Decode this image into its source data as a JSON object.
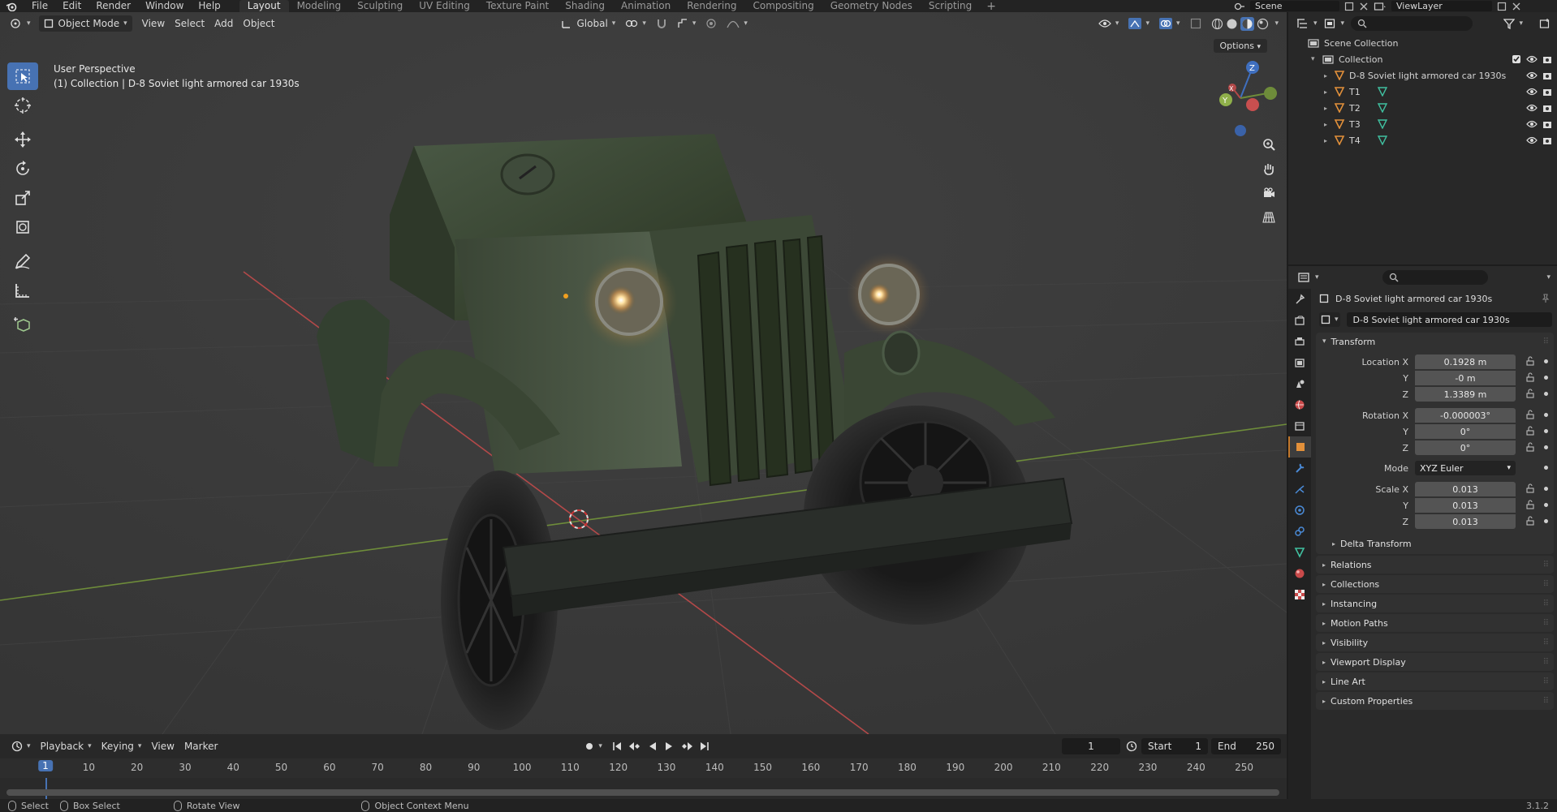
{
  "topbar": {
    "menus": [
      "File",
      "Edit",
      "Render",
      "Window",
      "Help"
    ],
    "workspaces": [
      "Layout",
      "Modeling",
      "Sculpting",
      "UV Editing",
      "Texture Paint",
      "Shading",
      "Animation",
      "Rendering",
      "Compositing",
      "Geometry Nodes",
      "Scripting"
    ],
    "active_workspace": "Layout",
    "add_workspace": "+",
    "scene": "Scene",
    "view_layer": "ViewLayer"
  },
  "viewport": {
    "mode": "Object Mode",
    "menus": [
      "View",
      "Select",
      "Add",
      "Object"
    ],
    "transform_orientation": "Global",
    "options_label": "Options",
    "perspective_label": "User Perspective",
    "collection_label": "(1) Collection | D-8 Soviet light armored car 1930s",
    "gizmo_axes": {
      "x": "X",
      "y": "Y",
      "z": "Z"
    },
    "colors": {
      "bg": "#393939",
      "x_axis": "#b34949",
      "y_axis": "#6e8c3a",
      "z_axis": "#3f6fbf",
      "body_green": "#3d4a38",
      "headlight": "#ffcf7a"
    }
  },
  "timeline": {
    "menus": [
      "Playback",
      "Keying",
      "View",
      "Marker"
    ],
    "current_frame": "1",
    "start_label": "Start",
    "start_value": "1",
    "end_label": "End",
    "end_value": "250",
    "ruler_current": "1",
    "ruler_ticks": [
      "10",
      "20",
      "30",
      "40",
      "50",
      "60",
      "70",
      "80",
      "90",
      "100",
      "110",
      "120",
      "130",
      "140",
      "150",
      "160",
      "170",
      "180",
      "190",
      "200",
      "210",
      "220",
      "230",
      "240",
      "250"
    ]
  },
  "statusbar": {
    "select": "Select",
    "box_select": "Box Select",
    "rotate_view": "Rotate View",
    "context_menu": "Object Context Menu",
    "version": "3.1.2"
  },
  "outliner": {
    "scene_collection": "Scene Collection",
    "collection": "Collection",
    "objects": [
      {
        "name": "D-8 Soviet light armored car 1930s"
      },
      {
        "name": "T1"
      },
      {
        "name": "T2"
      },
      {
        "name": "T3"
      },
      {
        "name": "T4"
      }
    ]
  },
  "properties": {
    "object_name": "D-8 Soviet light armored car 1930s",
    "object_field": "D-8 Soviet light armored car 1930s",
    "transform_title": "Transform",
    "location_label": "Location X",
    "location": {
      "x": "0.1928 m",
      "y": "-0 m",
      "z": "1.3389 m"
    },
    "rotation_label": "Rotation X",
    "rotation": {
      "x": "-0.000003°",
      "y": "0°",
      "z": "0°"
    },
    "mode_label": "Mode",
    "mode_value": "XYZ Euler",
    "scale_label": "Scale X",
    "scale": {
      "x": "0.013",
      "y": "0.013",
      "z": "0.013"
    },
    "y_label": "Y",
    "z_label": "Z",
    "delta_transform": "Delta Transform",
    "panels": [
      "Relations",
      "Collections",
      "Instancing",
      "Motion Paths",
      "Visibility",
      "Viewport Display",
      "Line Art",
      "Custom Properties"
    ]
  }
}
